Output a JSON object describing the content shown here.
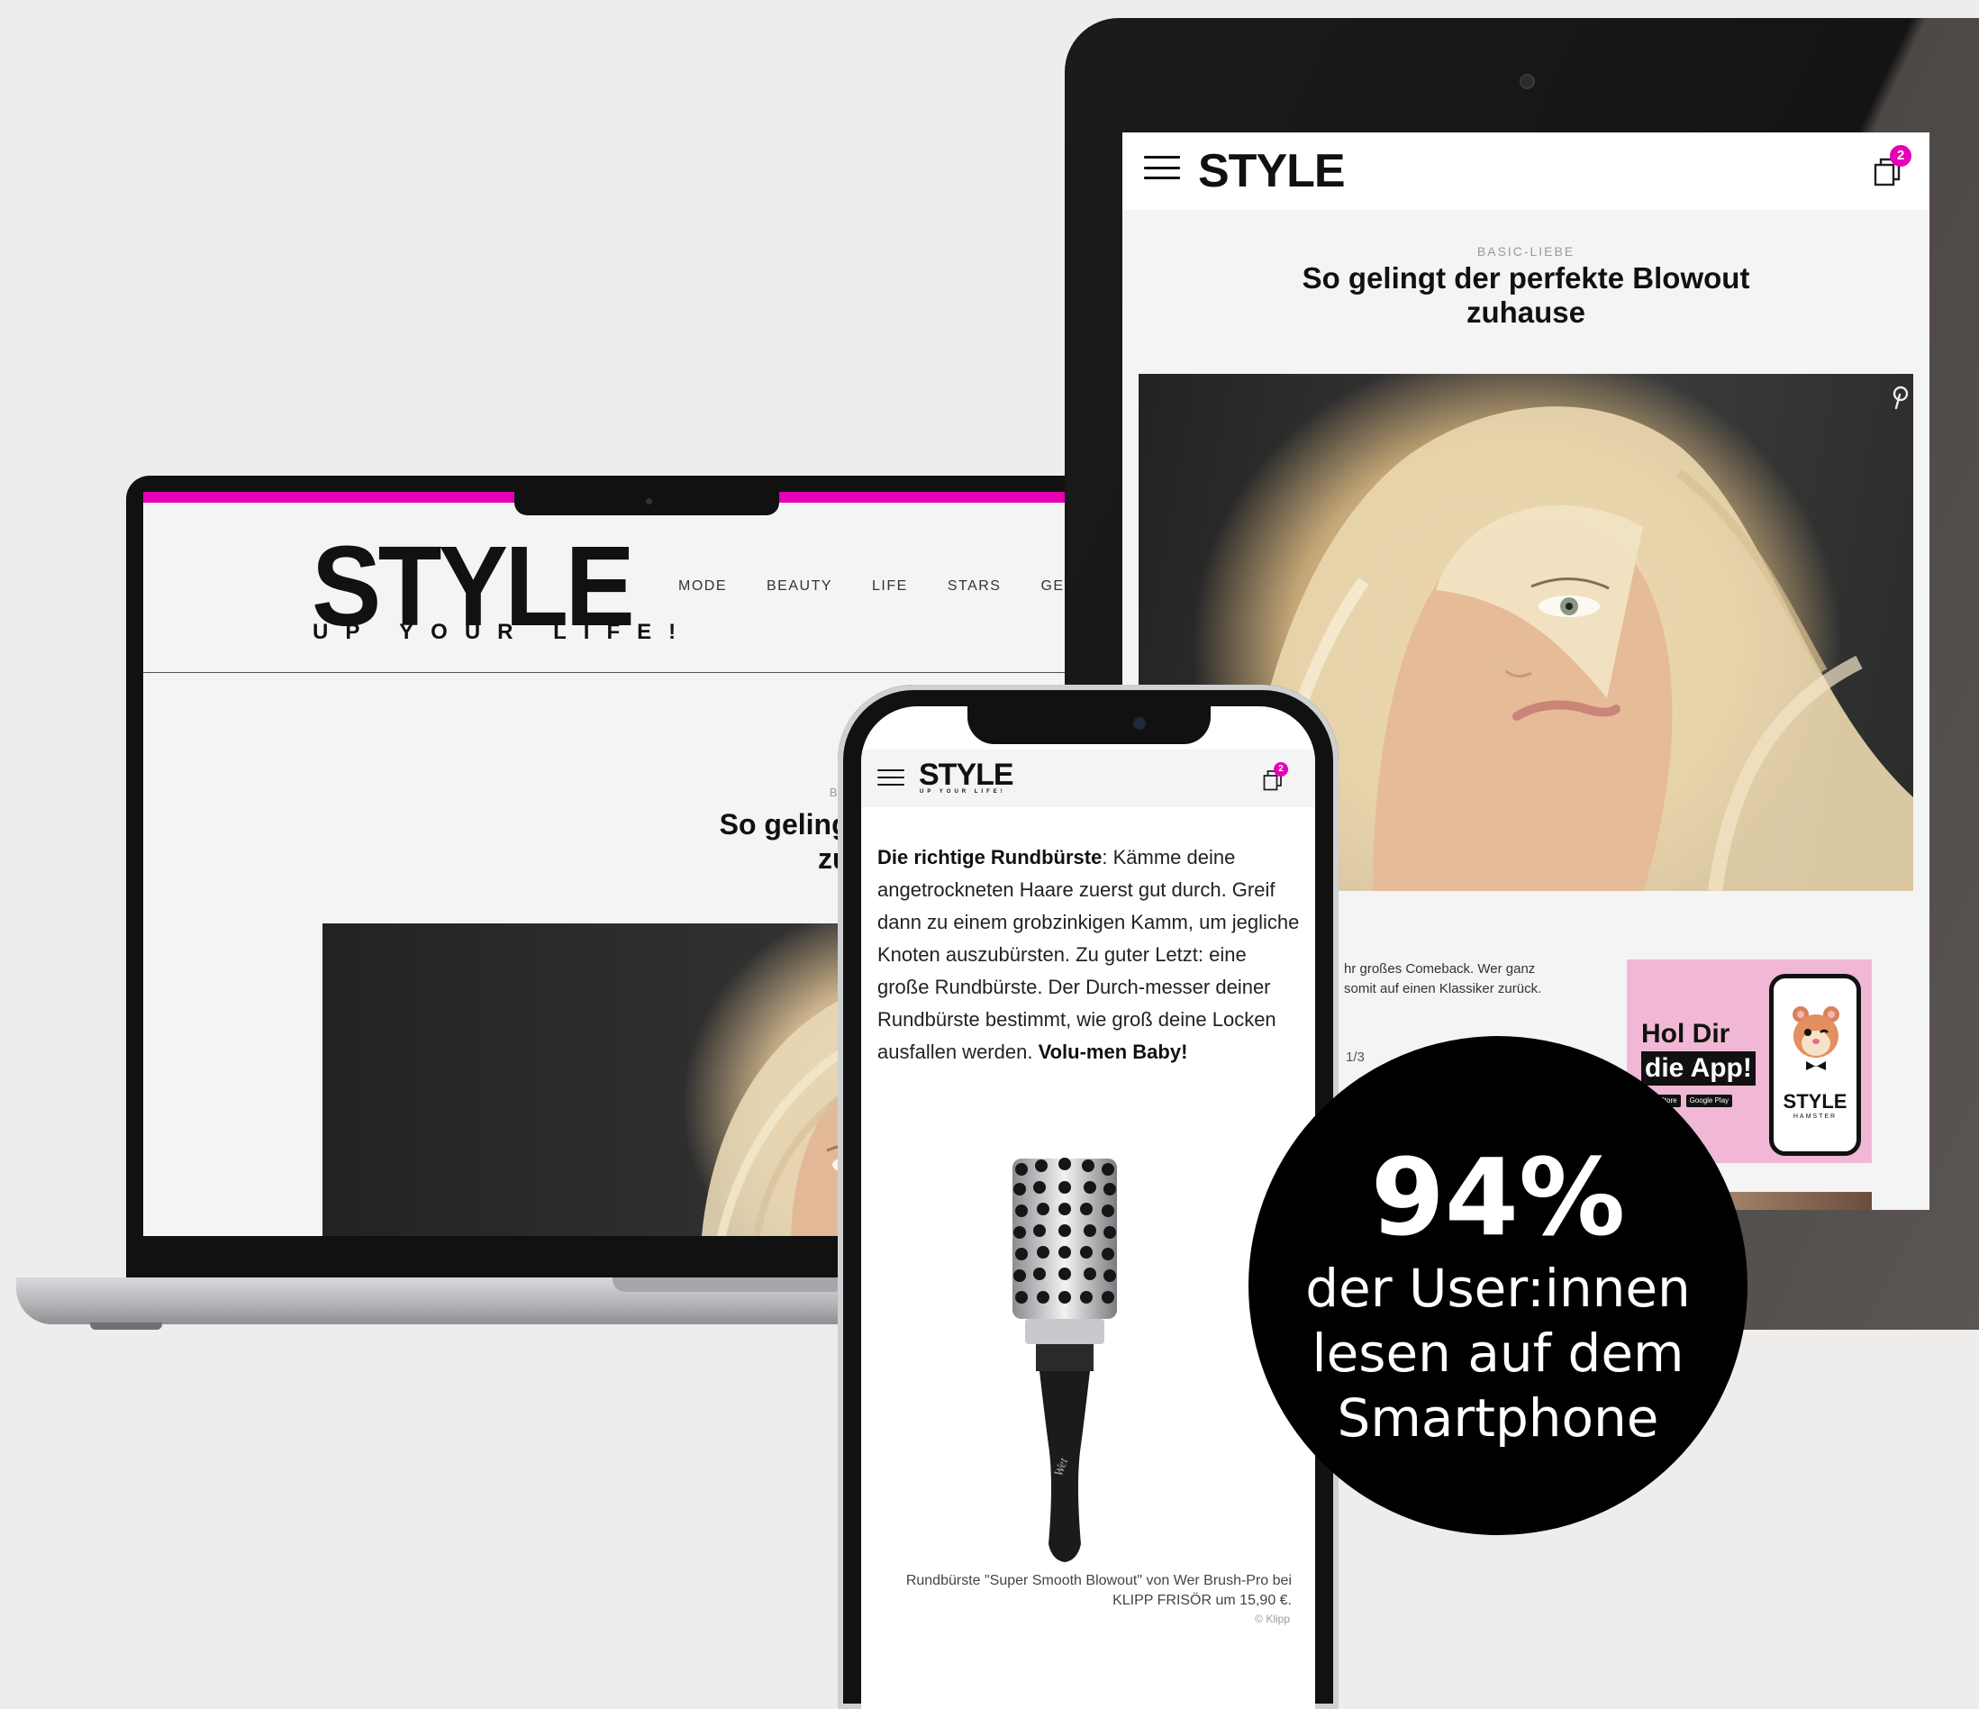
{
  "colors": {
    "accent": "#e600b5",
    "background": "#efedeb",
    "stat_circle": "#000000"
  },
  "laptop": {
    "logo": "STYLE",
    "tagline": "UP YOUR LIFE!",
    "nav": [
      "MODE",
      "BEAUTY",
      "LIFE",
      "STARS",
      "GEW"
    ],
    "kicker": "BASIC-LIEBE",
    "title_line1": "So gelingt der perfekte",
    "title_line2": "zuhause"
  },
  "tablet": {
    "logo": "STYLE",
    "cart_count": "2",
    "kicker": "BASIC-LIEBE",
    "title_line1": "So gelingt der perfekte Blowout",
    "title_line2": "zuhause",
    "icons": [
      "menu-icon",
      "cart-icon",
      "pinterest-icon"
    ],
    "snippet_line1": "hr großes Comeback. Wer ganz",
    "snippet_line2": "somit auf einen Klassiker zurück.",
    "slide_counter": "1/3",
    "ad": {
      "line1": "Hol Dir",
      "line2": "die App!",
      "store1": "App Store",
      "store2": "Google Play",
      "phone_logo": "STYLE",
      "phone_sub": "HAMSTER"
    }
  },
  "phone": {
    "logo": "STYLE",
    "tagline": "UP YOUR LIFE!",
    "cart_count": "2",
    "body_bold_lead": "Die richtige Rundbürste",
    "body_text": ": Kämme deine angetrockneten Haare zuerst gut durch. Greif dann zu einem grobzinkigen Kamm, um jegliche Knoten auszubürsten. Zu guter Letzt: eine große Rundbürste. Der Durch-messer deiner Rundbürste bestimmt, wie groß deine Locken ausfallen werden. ",
    "body_bold_end": "Volu-men Baby!",
    "caption_line1": "Rundbürste \"Super Smooth Blowout\" von Wer Brush-Pro bei",
    "caption_line2": "KLIPP FRISÖR um 15,90 €.",
    "credit": "© Klipp"
  },
  "stat": {
    "value": "94%",
    "line1": "der User:innen",
    "line2": "lesen auf dem",
    "line3": "Smartphone"
  }
}
